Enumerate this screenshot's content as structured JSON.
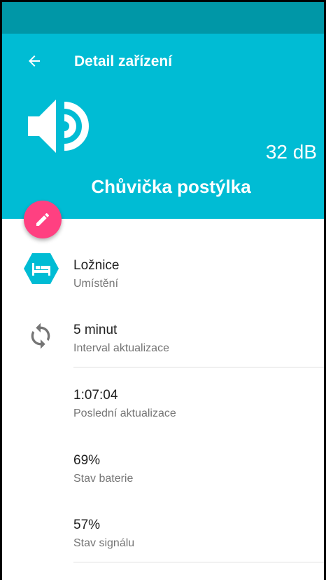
{
  "header": {
    "title": "Detail zařízení",
    "db_value": "32 dB",
    "device_name": "Chůvička postýlka",
    "back_icon": "arrow-left-icon",
    "device_icon": "speaker-icon",
    "edit_icon": "pencil-icon"
  },
  "details": {
    "location": {
      "value": "Ložnice",
      "label": "Umístění",
      "icon": "bed-icon"
    },
    "interval": {
      "value": "5 minut",
      "label": "Interval aktualizace",
      "icon": "sync-icon"
    },
    "last_update": {
      "value": "1:07:04",
      "label": "Poslední aktualizace"
    },
    "battery": {
      "value": "69%",
      "label": "Stav baterie"
    },
    "signal": {
      "value": "57%",
      "label": "Stav signálu"
    }
  },
  "colors": {
    "status_bar": "#0097a7",
    "primary": "#00bcd4",
    "accent": "#ff4081",
    "icon_gray": "#757575"
  }
}
